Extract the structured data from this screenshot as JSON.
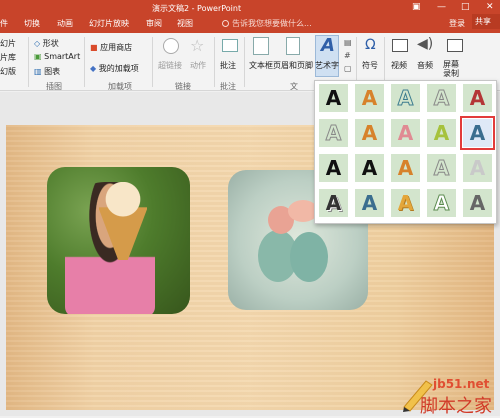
{
  "title_bar": {
    "doc_title": "演示文稿2 - PowerPoint",
    "tabs": [
      "件",
      "切换",
      "动画",
      "幻灯片放映",
      "审阅",
      "视图"
    ],
    "tell_me": "告诉我您想要做什么...",
    "login": "登录",
    "share": "共享",
    "window_buttons": [
      "▣",
      "—",
      "□",
      "✕"
    ]
  },
  "ribbon": {
    "left_items": [
      "幻片",
      "片库",
      "幻版"
    ],
    "shape_label": "形状",
    "smartart_label": "SmartArt",
    "chart_label": "图表",
    "group_illustrations": "插图",
    "store_label": "应用商店",
    "my_addins_label": "我的加载项",
    "group_addins": "加载项",
    "hyperlink_label": "超链接",
    "action_label": "动作",
    "group_links": "链接",
    "comment_label": "批注",
    "group_comments": "批注",
    "textbox_label": "文本框",
    "header_footer_label": "页眉和页脚",
    "wordart_label": "艺术字",
    "group_text": "文",
    "symbol_label": "符号",
    "video_label": "视频",
    "audio_label": "音频",
    "screen_record_label": "屏幕录制"
  },
  "wordart_gallery": {
    "glyph": "A",
    "selected_index": 9,
    "styles": [
      "black",
      "orange",
      "teal-outline",
      "grey-outline",
      "red",
      "grey-outline",
      "orange",
      "pink",
      "lime",
      "blue",
      "black",
      "black",
      "orange",
      "grey-outline",
      "lightgrey",
      "dark",
      "blue",
      "gold",
      "green-outline",
      "stripe"
    ]
  },
  "watermark": {
    "site": "jb51.net",
    "name": "脚本之家"
  }
}
